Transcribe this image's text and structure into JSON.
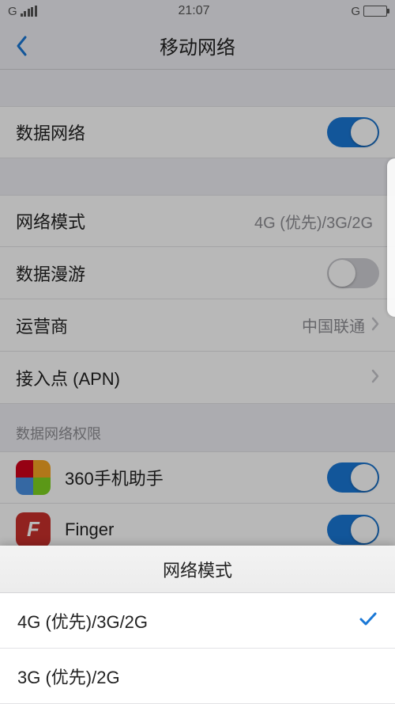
{
  "status": {
    "carrier_left": "G",
    "time": "21:07",
    "carrier_right": "G"
  },
  "nav": {
    "title": "移动网络"
  },
  "rows": {
    "data_network": {
      "label": "数据网络",
      "on": true
    },
    "network_mode": {
      "label": "网络模式",
      "value": "4G (优先)/3G/2G"
    },
    "roaming": {
      "label": "数据漫游",
      "on": false
    },
    "carrier": {
      "label": "运营商",
      "value": "中国联通"
    },
    "apn": {
      "label": "接入点 (APN)"
    }
  },
  "permissions_header": "数据网络权限",
  "apps": [
    {
      "name": "360手机助手",
      "on": true,
      "icon": "colorful"
    },
    {
      "name": "Finger",
      "on": true,
      "icon": "red",
      "glyph": "F"
    }
  ],
  "sheet": {
    "title": "网络模式",
    "options": [
      {
        "label": "4G (优先)/3G/2G",
        "selected": true
      },
      {
        "label": "3G (优先)/2G",
        "selected": false
      }
    ]
  }
}
